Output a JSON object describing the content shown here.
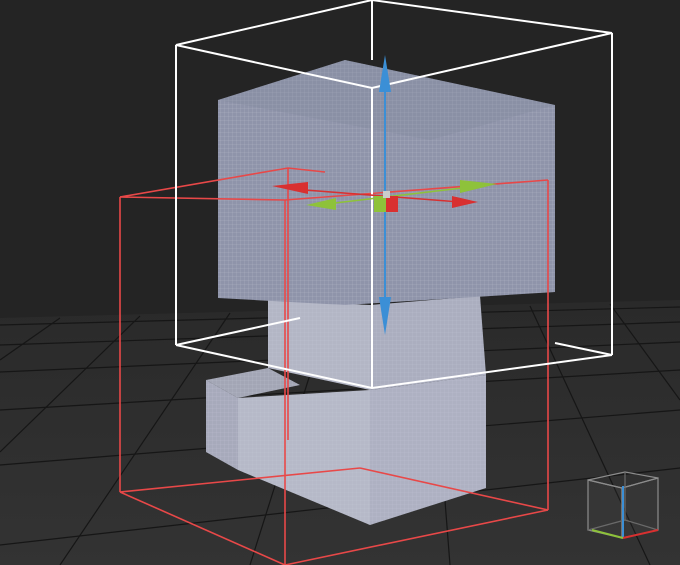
{
  "viewport": {
    "background_top": "#242424",
    "floor_color": "#2f2f2f",
    "grid_color": "#151515"
  },
  "selection_box_color": "#ffffff",
  "secondary_box_color": "#e84848",
  "mesh": {
    "face_top": "#7c8297",
    "face_front": "#8a90a6",
    "face_side": "#9a9eb0",
    "pattern_line": "#c8ccd8"
  },
  "gizmo": {
    "x_axis_color": "#d93030",
    "y_axis_color": "#8ec23a",
    "z_axis_color": "#3b8fd6"
  },
  "view_cube": {
    "label": "view-cube",
    "x_axis_color": "#d93030",
    "y_axis_color": "#8ec23a",
    "z_axis_color": "#3b8fd6",
    "box_color": "#8c8c8c"
  }
}
